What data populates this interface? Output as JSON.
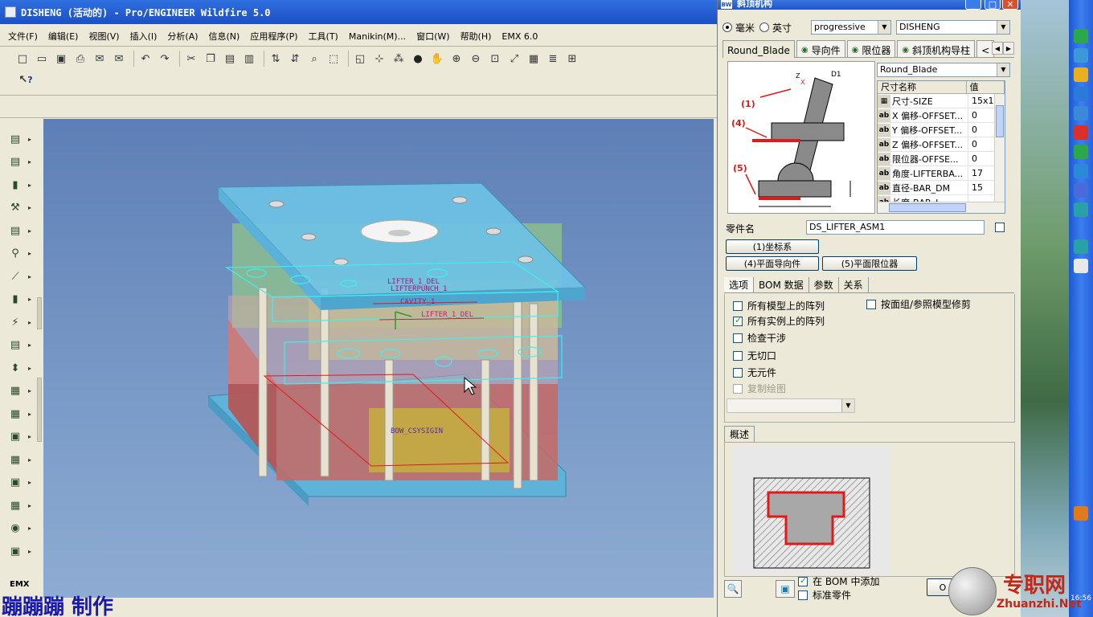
{
  "window": {
    "title": "DISHENG (活动的) - Pro/ENGINEER Wildfire 5.0"
  },
  "menu": [
    "文件(F)",
    "编辑(E)",
    "视图(V)",
    "插入(I)",
    "分析(A)",
    "信息(N)",
    "应用程序(P)",
    "工具(T)",
    "Manikin(M)...",
    "窗口(W)",
    "帮助(H)",
    "EMX 6.0"
  ],
  "toolbar": {
    "icons": [
      "new-icon",
      "open-icon",
      "save-icon",
      "print-icon",
      "send-icon",
      "email-icon",
      "undo-icon",
      "redo-icon",
      "cut-icon",
      "copy-icon",
      "paste-icon",
      "paste-special-icon",
      "regenerate-icon",
      "regenerate-manager-icon",
      "find-icon",
      "select-box-icon",
      "datum-plane-display-icon",
      "datum-axis-display-icon",
      "datum-point-display-icon",
      "shading-icon",
      "spin-icon",
      "zoom-in-icon",
      "zoom-out-icon",
      "refit-icon",
      "reorient-icon",
      "saved-views-icon",
      "layers-icon",
      "model-tree-icon"
    ],
    "context_help": "?"
  },
  "left_tools": [
    "mold-base-icon",
    "plate-icon",
    "ejector-pin-icon",
    "screw-icon",
    "guide-icon",
    "slider-icon",
    "pin-icon",
    "sprue-icon",
    "lifter-icon",
    "cooling-icon",
    "gate-icon",
    "insert-icon",
    "component-icon",
    "delete-icon",
    "view-icon",
    "bom-icon",
    "drawing-icon",
    "visibility-icon",
    "emx-icon"
  ],
  "left_tools_footer": "EMX",
  "viewport": {
    "annotations": [
      "LIFTER_1_DEL",
      "LIFTERPUNCH_1",
      "CAVITY_1",
      "LIFTER_1_DEL",
      "BOW_CSYSIGIN"
    ]
  },
  "credit": "蹦蹦蹦 制作",
  "dialog": {
    "title": "斜顶机构",
    "units": {
      "mm": "毫米",
      "inch": "英寸",
      "selected": "mm"
    },
    "type_select": "progressive",
    "project_select": "DISHENG",
    "tabs": [
      {
        "label": "Round_Blade",
        "eye": false
      },
      {
        "label": "导向件",
        "eye": true
      },
      {
        "label": "限位器",
        "eye": true
      },
      {
        "label": "斜顶机构导柱",
        "eye": true
      },
      {
        "label": "<",
        "eye": false
      }
    ],
    "shape_select": "Round_Blade",
    "diagram_labels": {
      "d1": "D1",
      "z": "Z",
      "x": "X",
      "c1": "(1)",
      "c4": "(4)",
      "c5": "(5)"
    },
    "table": {
      "headers": [
        "尺寸名称",
        "值"
      ],
      "rows": [
        {
          "icon": "grid",
          "name": "尺寸-SIZE",
          "value": "15x10"
        },
        {
          "icon": "ab",
          "name": "X 偏移-OFFSET...",
          "value": "0"
        },
        {
          "icon": "ab",
          "name": "Y 偏移-OFFSET...",
          "value": "0"
        },
        {
          "icon": "ab",
          "name": "Z 偏移-OFFSET...",
          "value": "0"
        },
        {
          "icon": "ab",
          "name": "限位器-OFFSE...",
          "value": "0"
        },
        {
          "icon": "ab",
          "name": "角度-LIFTERBA...",
          "value": "17"
        },
        {
          "icon": "ab",
          "name": "直径-BAR_DM",
          "value": "15"
        },
        {
          "icon": "ab",
          "name": "长度-BAR_L...",
          "value": "..."
        }
      ]
    },
    "part_name_label": "零件名",
    "part_name_value": "DS_LIFTER_ASM1",
    "buttons": {
      "coord": "(1)坐标系",
      "plane_guide": "(4)平面导向件",
      "plane_stop": "(5)平面限位器"
    },
    "subtabs": [
      "选项",
      "BOM 数据",
      "参数",
      "关系"
    ],
    "options": [
      {
        "label": "所有模型上的阵列",
        "checked": false,
        "disabled": false
      },
      {
        "label": "所有实例上的阵列",
        "checked": true,
        "disabled": false
      },
      {
        "label": "检查干涉",
        "checked": false,
        "disabled": false
      },
      {
        "label": "无切口",
        "checked": false,
        "disabled": false
      },
      {
        "label": "无元件",
        "checked": false,
        "disabled": false
      },
      {
        "label": "复制绘图",
        "checked": false,
        "disabled": true
      }
    ],
    "option_right": {
      "label": "按面组/参照模型修剪",
      "checked": false
    },
    "desc_tab": "概述",
    "bom_add": {
      "label": "在 BOM 中添加",
      "checked": true
    },
    "std_part": {
      "label": "标准零件",
      "checked": false
    },
    "ok_label": "O"
  },
  "watermark": {
    "text": "专职网",
    "url": "Zhuanzhi.Net"
  },
  "clock": "16:56",
  "colors": {
    "titlebar": "#1c4fc4",
    "mold_cyan": "#4cc6e0",
    "mold_red": "#c85a58",
    "mold_green": "#6fae6f",
    "accent_red": "#e01a1a"
  }
}
